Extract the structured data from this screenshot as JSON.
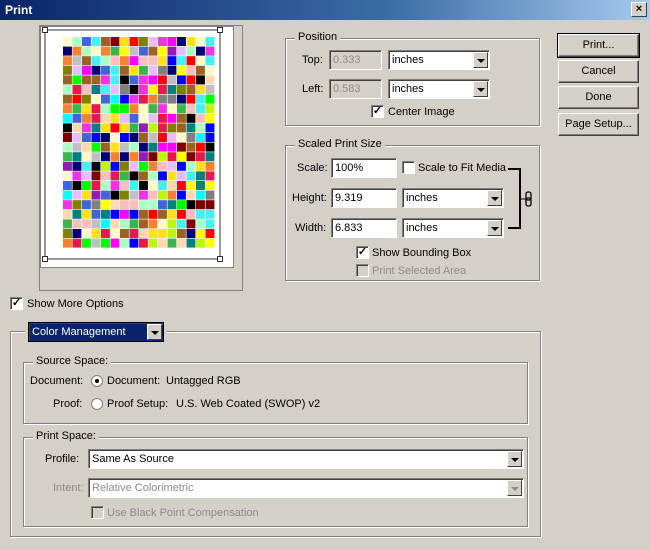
{
  "window": {
    "title": "Print",
    "close_glyph": "×"
  },
  "position": {
    "legend": "Position",
    "top_label": "Top:",
    "top_value": "0.333",
    "top_unit": "inches",
    "left_label": "Left:",
    "left_value": "0.583",
    "left_unit": "inches",
    "center_label": "Center Image",
    "center_checked": true
  },
  "scaled": {
    "legend": "Scaled Print Size",
    "scale_label": "Scale:",
    "scale_value": "100%",
    "fit_label": "Scale to Fit Media",
    "fit_checked": false,
    "height_label": "Height:",
    "height_value": "9.319",
    "height_unit": "inches",
    "width_label": "Width:",
    "width_value": "6.833",
    "width_unit": "inches",
    "bbox_label": "Show Bounding Box",
    "bbox_checked": true,
    "selected_label": "Print Selected Area",
    "selected_checked": false
  },
  "buttons": {
    "print": "Print...",
    "cancel": "Cancel",
    "done": "Done",
    "page_setup": "Page Setup..."
  },
  "more_options": {
    "label": "Show More Options",
    "checked": true
  },
  "options_select": "Color Management",
  "source": {
    "legend": "Source Space:",
    "document_label": "Document:",
    "document_option": "Document:",
    "document_profile": "Untagged RGB",
    "proof_label": "Proof:",
    "proof_option": "Proof Setup:",
    "proof_profile": "U.S. Web Coated (SWOP) v2",
    "selected": "document"
  },
  "print_space": {
    "legend": "Print Space:",
    "profile_label": "Profile:",
    "profile_value": "Same As Source",
    "intent_label": "Intent:",
    "intent_value": "Relative Colorimetric",
    "bpc_label": "Use Black Point Compensation",
    "bpc_checked": false
  },
  "icons": {
    "chain": "chain-link-icon",
    "checkmark": "✓"
  },
  "colors": {
    "dialog_bg": "#d4d0c8",
    "titlebar": "#0a246a",
    "selection": "#0a246a",
    "disabled_text": "#8c8c8c"
  }
}
